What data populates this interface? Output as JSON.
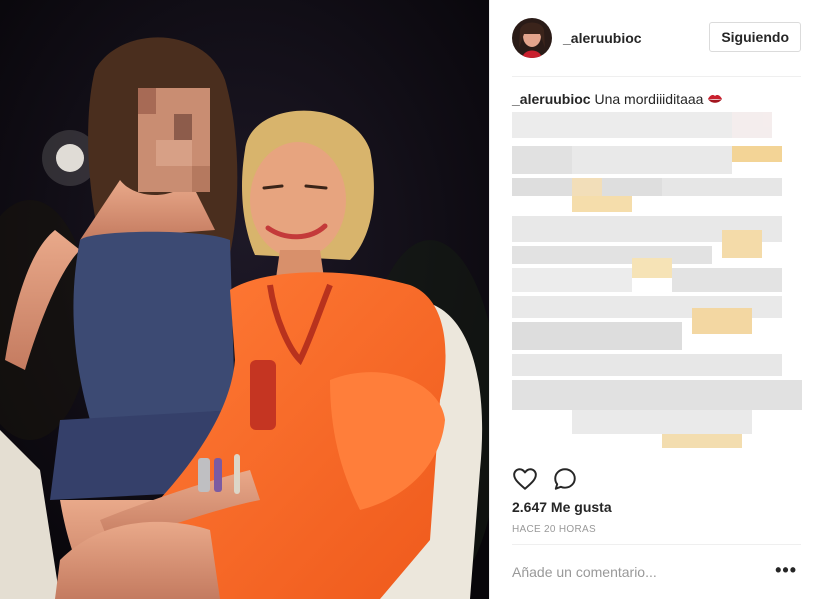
{
  "post": {
    "username": "_aleruubioc",
    "follow_label": "Siguiendo",
    "caption_user": "_aleruubioc",
    "caption_text": "Una mordiiiditaaa",
    "caption_emoji": "kiss-mark-icon",
    "likes": "2.647 Me gusta",
    "time": "HACE 20 HORAS",
    "comment_placeholder": "Añade un comentario...",
    "more_label": "•••"
  },
  "icons": {
    "like": "heart-icon",
    "comment": "comment-icon",
    "more": "more-options-icon"
  },
  "colors": {
    "dress": "#ff6d2a",
    "top": "#3c4a73",
    "background": "#0d0b10",
    "emoji_lips": "#c9202e"
  }
}
